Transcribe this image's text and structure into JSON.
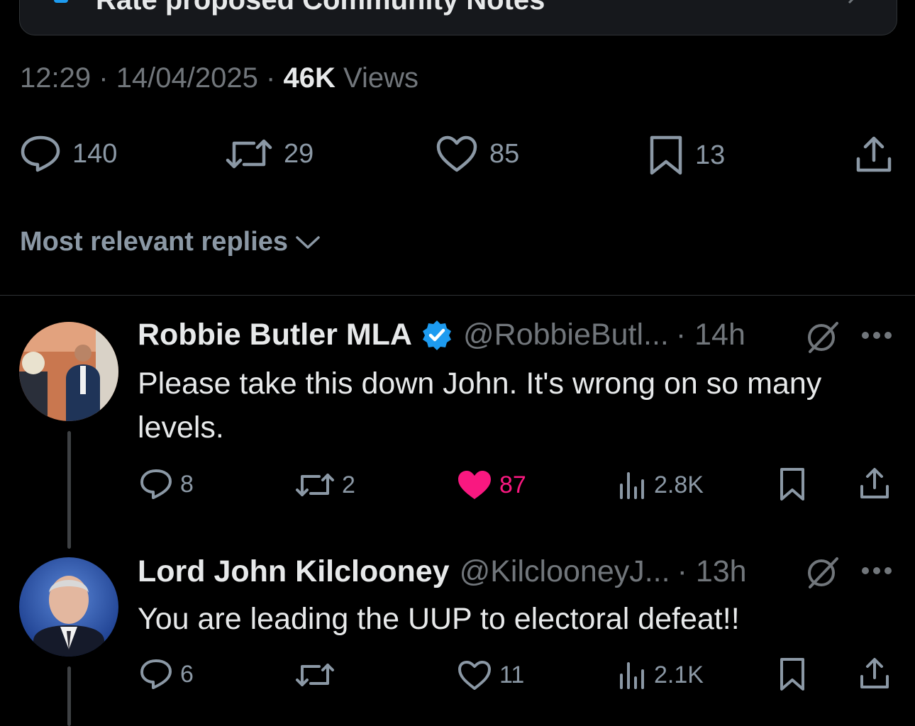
{
  "community_notes": {
    "label": "Rate proposed Community Notes"
  },
  "post_meta": {
    "time": "12:29",
    "date": "14/04/2025",
    "views_count": "46K",
    "views_label": "Views",
    "sep": "·"
  },
  "post_stats": {
    "replies": "140",
    "reposts": "29",
    "likes": "85",
    "bookmarks": "13"
  },
  "replies_sort": {
    "label": "Most relevant replies"
  },
  "colors": {
    "background": "#000000",
    "text": "#e7e9ea",
    "muted": "#71767b",
    "like_active": "#f91880",
    "verified": "#1d9bf0"
  },
  "replies": [
    {
      "display_name": "Robbie Butler MLA",
      "handle": "@RobbieButl...",
      "time": "· 14h",
      "verified": true,
      "text": "Please take this down John. It's wrong on so many levels.",
      "replies": "8",
      "reposts": "2",
      "likes": "87",
      "liked": true,
      "views": "2.8K"
    },
    {
      "display_name": "Lord John Kilclooney",
      "handle": "@KilclooneyJ...",
      "time": "· 13h",
      "verified": false,
      "text": "You are leading the UUP to electoral defeat!!",
      "replies": "6",
      "reposts": "",
      "likes": "11",
      "liked": false,
      "views": "2.1K"
    }
  ]
}
